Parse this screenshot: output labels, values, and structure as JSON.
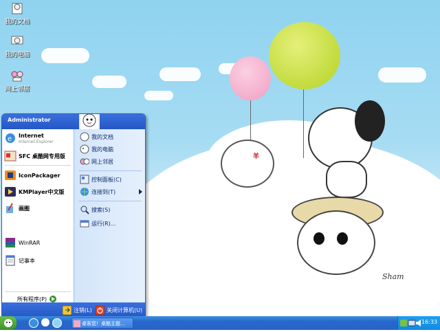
{
  "desktop": {
    "icons": [
      {
        "label": "我的文档"
      },
      {
        "label": "我的电脑"
      },
      {
        "label": "网上邻居"
      }
    ],
    "signature": "Sham",
    "bubble_text": "羊"
  },
  "start_menu": {
    "user": "Administrator",
    "pinned": [
      {
        "label": "Internet",
        "sub": "Internet Explorer"
      },
      {
        "label": "SFC 桌酷网专用版"
      }
    ],
    "recent": [
      {
        "label": "IconPackager"
      },
      {
        "label": "KMPlayer中文版"
      },
      {
        "label": "画图"
      },
      {
        "label": "WinRAR"
      },
      {
        "label": "记事本"
      }
    ],
    "all_programs": "所有程序(P)",
    "places": [
      {
        "label": "我的文档"
      },
      {
        "label": "我的电脑"
      },
      {
        "label": "网上邻居"
      }
    ],
    "system": [
      {
        "label": "控制面板(C)"
      },
      {
        "label": "连接到(T)"
      },
      {
        "label": "搜索(S)"
      },
      {
        "label": "运行(R)..."
      }
    ],
    "logoff": "注销(L)",
    "shutdown": "关闭计算机(U)"
  },
  "taskbar": {
    "task_label": "桌客您！桌酷主题...",
    "clock": "16:33"
  },
  "colors": {
    "sky": "#8fd3f0",
    "menu_blue": "#2457c5",
    "start_green": "#3a9428",
    "balloon_pink": "#f5a8c8",
    "balloon_green": "#b8d72c"
  }
}
